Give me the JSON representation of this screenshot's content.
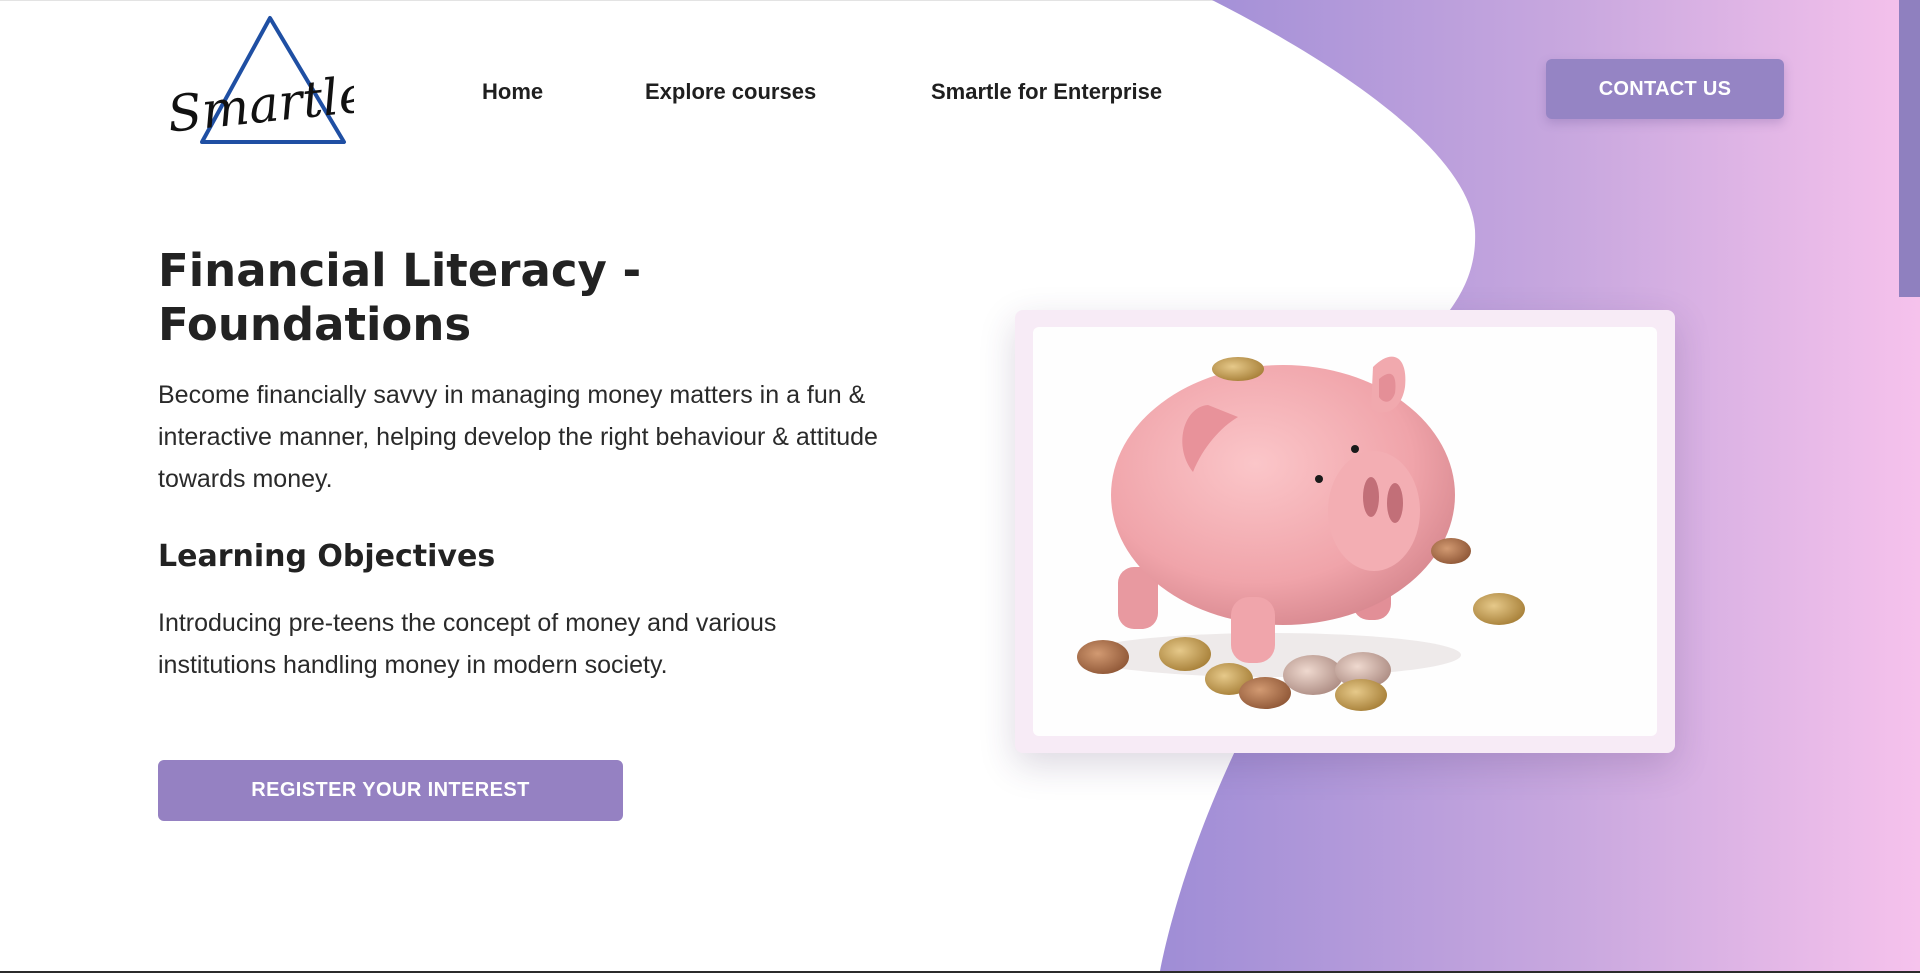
{
  "brand": {
    "logo_name": "Smartle",
    "logo_icon": "triangle-logo-icon",
    "colors": {
      "accent": "#9584c4",
      "gradient_start": "#9f8dd6",
      "gradient_end": "#f6c2ec",
      "card_bg": "#f7ebf6",
      "text": "#222222"
    }
  },
  "nav": {
    "items": [
      {
        "label": "Home"
      },
      {
        "label": "Explore courses"
      },
      {
        "label": "Smartle for Enterprise"
      }
    ],
    "contact_label": "CONTACT US"
  },
  "hero": {
    "title": "Financial Literacy - Foundations",
    "description": "Become financially savvy in managing money matters in a fun & interactive manner, helping develop the right behaviour & attitude towards money.",
    "objectives_heading": "Learning Objectives",
    "objectives_text": "Introducing pre-teens the concept of money and various institutions handling money in modern society.",
    "register_label": "REGISTER YOUR INTEREST"
  },
  "image": {
    "subject": "piggy-bank-with-coins",
    "icon": "piggy-bank-icon"
  }
}
